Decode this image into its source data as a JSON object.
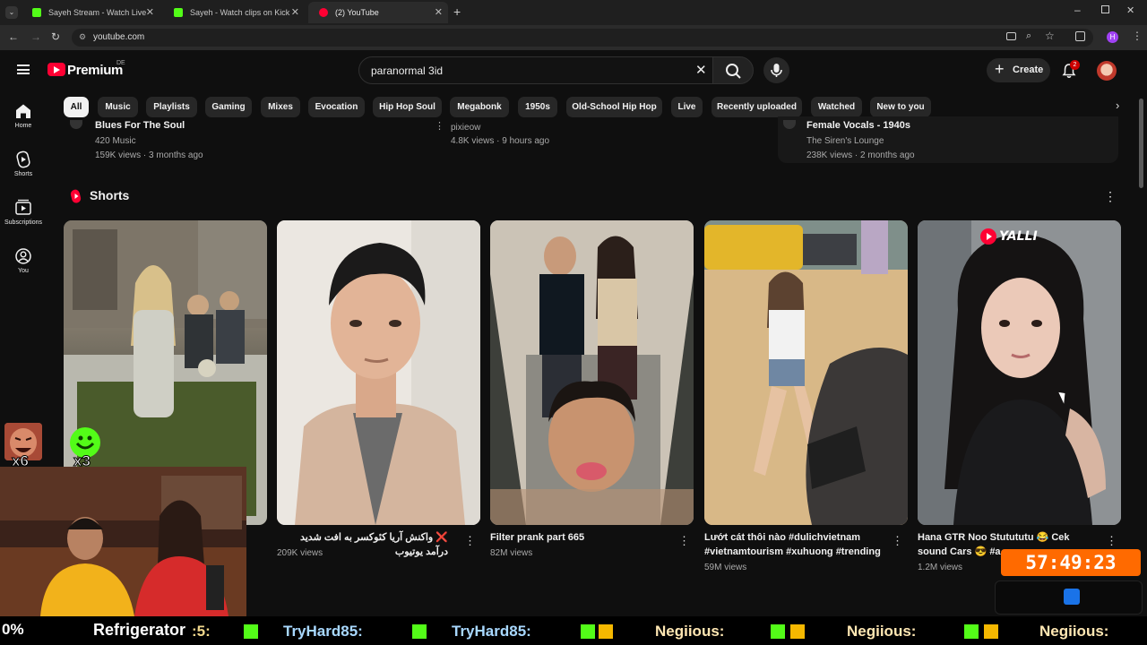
{
  "browser": {
    "tabs": [
      {
        "title": "Sayeh Stream - Watch Live on K",
        "favicon_color": "#53fc18"
      },
      {
        "title": "Sayeh - Watch clips on Kick",
        "favicon_color": "#53fc18"
      },
      {
        "title": "(2) YouTube",
        "favicon_color": "#ff0033"
      }
    ],
    "url": "youtube.com"
  },
  "youtube": {
    "logo": "Premium",
    "country": "DE",
    "search_query": "paranormal 3id",
    "create_label": "Create",
    "notifications_count": "2",
    "avatar_letter": "H",
    "sidebar": [
      {
        "label": "Home",
        "icon": "home-icon"
      },
      {
        "label": "Shorts",
        "icon": "shorts-icon"
      },
      {
        "label": "Subscriptions",
        "icon": "subscriptions-icon"
      },
      {
        "label": "You",
        "icon": "you-icon"
      }
    ],
    "chips": [
      "All",
      "Music",
      "Playlists",
      "Gaming",
      "Mixes",
      "Evocation",
      "Hip Hop Soul",
      "Megabonk",
      "1950s",
      "Old-School Hip Hop",
      "Live",
      "Recently uploaded",
      "Watched",
      "New to you"
    ],
    "prev_row": [
      {
        "title": "Blues For The Soul",
        "channel": "420 Music",
        "meta": "159K views · 3 months ago"
      },
      {
        "title": "",
        "channel": "pixieow",
        "meta": "4.8K views · 9 hours ago"
      },
      {
        "title": "Female Vocals - 1940s",
        "channel": "The Siren's Lounge",
        "meta": "238K views · 2 months ago"
      }
    ],
    "shorts_heading": "Shorts",
    "shorts": [
      {
        "title": "",
        "views": ""
      },
      {
        "title": "❌ واکنش آریا کئوکسر به افت شدید درآمد یوتیوب",
        "views": "209K views"
      },
      {
        "title": "Filter prank part 665",
        "views": "82M views"
      },
      {
        "title": "Lướt cát thôi nào #dulichvietnam #vietnamtourism #xuhuong #trending",
        "views": "59M views"
      },
      {
        "title": "Hana GTR  Noo Stutututu 😂 Cek sound Cars 😎 #a",
        "views": "1.2M views"
      }
    ],
    "yalli_badge": "YALLI"
  },
  "overlay": {
    "multiplier_1": "x6",
    "multiplier_2": "x3",
    "percent": "0%",
    "now_playing": "Refrigerator",
    "timer": "57:49:23",
    "ticker": [
      ":5:",
      "TryHard85:",
      "TryHard85:",
      "Negiious:",
      "Negiious:",
      "Negiious:"
    ]
  },
  "colors": {
    "accent": "#ff0033",
    "kick_green": "#53fc18",
    "timer_bg": "#ff6a00"
  }
}
